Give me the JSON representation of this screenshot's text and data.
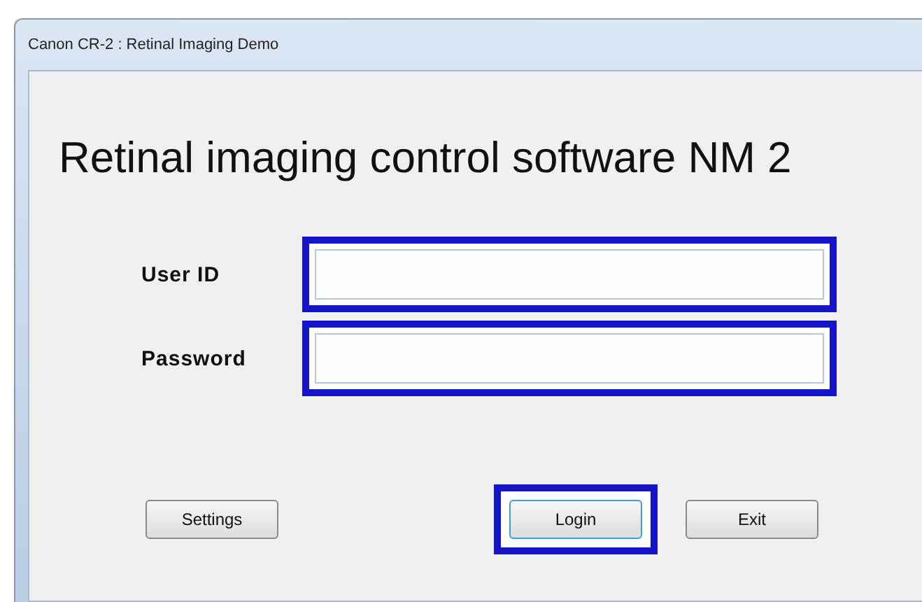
{
  "window": {
    "title": "Canon CR-2 : Retinal Imaging Demo"
  },
  "heading": "Retinal imaging control software NM 2",
  "fields": [
    {
      "label": "User ID",
      "highlighted": true
    },
    {
      "label": "Password",
      "highlighted": true
    }
  ],
  "buttons": [
    {
      "label": "Settings",
      "highlighted": false
    },
    {
      "label": "Login",
      "highlighted": true
    },
    {
      "label": "Exit",
      "highlighted": false
    }
  ]
}
